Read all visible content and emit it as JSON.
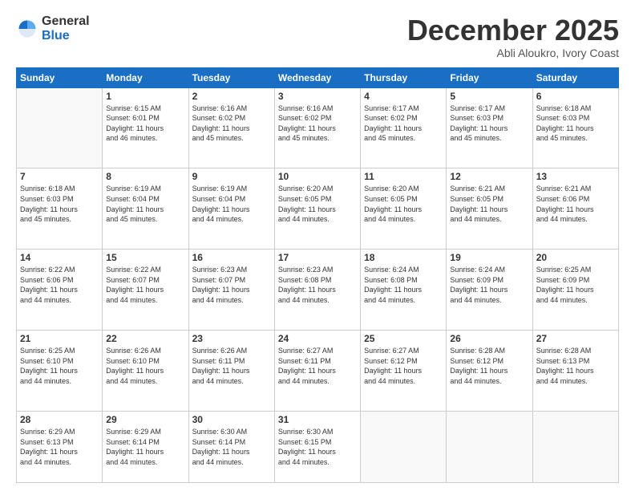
{
  "logo": {
    "general": "General",
    "blue": "Blue"
  },
  "header": {
    "month": "December 2025",
    "location": "Abli Aloukro, Ivory Coast"
  },
  "days": [
    "Sunday",
    "Monday",
    "Tuesday",
    "Wednesday",
    "Thursday",
    "Friday",
    "Saturday"
  ],
  "weeks": [
    [
      {
        "day": "",
        "info": ""
      },
      {
        "day": "1",
        "info": "Sunrise: 6:15 AM\nSunset: 6:01 PM\nDaylight: 11 hours\nand 46 minutes."
      },
      {
        "day": "2",
        "info": "Sunrise: 6:16 AM\nSunset: 6:02 PM\nDaylight: 11 hours\nand 45 minutes."
      },
      {
        "day": "3",
        "info": "Sunrise: 6:16 AM\nSunset: 6:02 PM\nDaylight: 11 hours\nand 45 minutes."
      },
      {
        "day": "4",
        "info": "Sunrise: 6:17 AM\nSunset: 6:02 PM\nDaylight: 11 hours\nand 45 minutes."
      },
      {
        "day": "5",
        "info": "Sunrise: 6:17 AM\nSunset: 6:03 PM\nDaylight: 11 hours\nand 45 minutes."
      },
      {
        "day": "6",
        "info": "Sunrise: 6:18 AM\nSunset: 6:03 PM\nDaylight: 11 hours\nand 45 minutes."
      }
    ],
    [
      {
        "day": "7",
        "info": "Sunrise: 6:18 AM\nSunset: 6:03 PM\nDaylight: 11 hours\nand 45 minutes."
      },
      {
        "day": "8",
        "info": "Sunrise: 6:19 AM\nSunset: 6:04 PM\nDaylight: 11 hours\nand 45 minutes."
      },
      {
        "day": "9",
        "info": "Sunrise: 6:19 AM\nSunset: 6:04 PM\nDaylight: 11 hours\nand 44 minutes."
      },
      {
        "day": "10",
        "info": "Sunrise: 6:20 AM\nSunset: 6:05 PM\nDaylight: 11 hours\nand 44 minutes."
      },
      {
        "day": "11",
        "info": "Sunrise: 6:20 AM\nSunset: 6:05 PM\nDaylight: 11 hours\nand 44 minutes."
      },
      {
        "day": "12",
        "info": "Sunrise: 6:21 AM\nSunset: 6:05 PM\nDaylight: 11 hours\nand 44 minutes."
      },
      {
        "day": "13",
        "info": "Sunrise: 6:21 AM\nSunset: 6:06 PM\nDaylight: 11 hours\nand 44 minutes."
      }
    ],
    [
      {
        "day": "14",
        "info": "Sunrise: 6:22 AM\nSunset: 6:06 PM\nDaylight: 11 hours\nand 44 minutes."
      },
      {
        "day": "15",
        "info": "Sunrise: 6:22 AM\nSunset: 6:07 PM\nDaylight: 11 hours\nand 44 minutes."
      },
      {
        "day": "16",
        "info": "Sunrise: 6:23 AM\nSunset: 6:07 PM\nDaylight: 11 hours\nand 44 minutes."
      },
      {
        "day": "17",
        "info": "Sunrise: 6:23 AM\nSunset: 6:08 PM\nDaylight: 11 hours\nand 44 minutes."
      },
      {
        "day": "18",
        "info": "Sunrise: 6:24 AM\nSunset: 6:08 PM\nDaylight: 11 hours\nand 44 minutes."
      },
      {
        "day": "19",
        "info": "Sunrise: 6:24 AM\nSunset: 6:09 PM\nDaylight: 11 hours\nand 44 minutes."
      },
      {
        "day": "20",
        "info": "Sunrise: 6:25 AM\nSunset: 6:09 PM\nDaylight: 11 hours\nand 44 minutes."
      }
    ],
    [
      {
        "day": "21",
        "info": "Sunrise: 6:25 AM\nSunset: 6:10 PM\nDaylight: 11 hours\nand 44 minutes."
      },
      {
        "day": "22",
        "info": "Sunrise: 6:26 AM\nSunset: 6:10 PM\nDaylight: 11 hours\nand 44 minutes."
      },
      {
        "day": "23",
        "info": "Sunrise: 6:26 AM\nSunset: 6:11 PM\nDaylight: 11 hours\nand 44 minutes."
      },
      {
        "day": "24",
        "info": "Sunrise: 6:27 AM\nSunset: 6:11 PM\nDaylight: 11 hours\nand 44 minutes."
      },
      {
        "day": "25",
        "info": "Sunrise: 6:27 AM\nSunset: 6:12 PM\nDaylight: 11 hours\nand 44 minutes."
      },
      {
        "day": "26",
        "info": "Sunrise: 6:28 AM\nSunset: 6:12 PM\nDaylight: 11 hours\nand 44 minutes."
      },
      {
        "day": "27",
        "info": "Sunrise: 6:28 AM\nSunset: 6:13 PM\nDaylight: 11 hours\nand 44 minutes."
      }
    ],
    [
      {
        "day": "28",
        "info": "Sunrise: 6:29 AM\nSunset: 6:13 PM\nDaylight: 11 hours\nand 44 minutes."
      },
      {
        "day": "29",
        "info": "Sunrise: 6:29 AM\nSunset: 6:14 PM\nDaylight: 11 hours\nand 44 minutes."
      },
      {
        "day": "30",
        "info": "Sunrise: 6:30 AM\nSunset: 6:14 PM\nDaylight: 11 hours\nand 44 minutes."
      },
      {
        "day": "31",
        "info": "Sunrise: 6:30 AM\nSunset: 6:15 PM\nDaylight: 11 hours\nand 44 minutes."
      },
      {
        "day": "",
        "info": ""
      },
      {
        "day": "",
        "info": ""
      },
      {
        "day": "",
        "info": ""
      }
    ]
  ]
}
